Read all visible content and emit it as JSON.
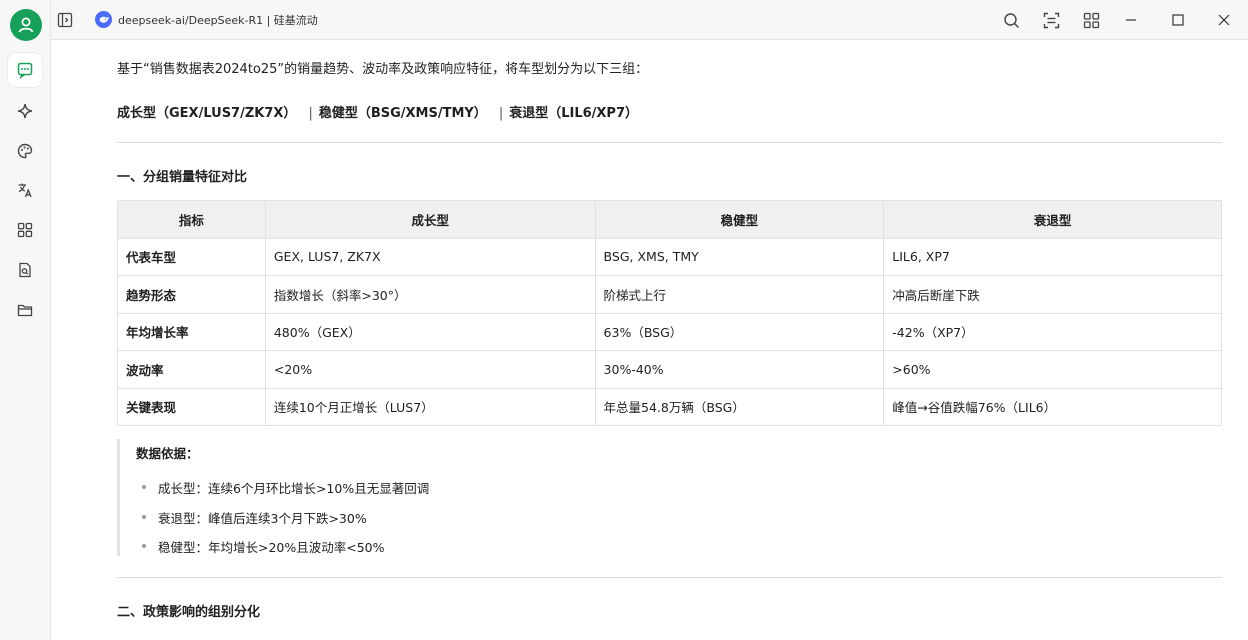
{
  "window": {
    "title": "deepseek-ai/DeepSeek-R1 | 硅基流动"
  },
  "rail": {
    "items": [
      {
        "name": "chat",
        "icon": "chat-icon"
      },
      {
        "name": "sparkle",
        "icon": "sparkle-icon"
      },
      {
        "name": "palette",
        "icon": "palette-icon"
      },
      {
        "name": "translate",
        "icon": "translate-icon"
      },
      {
        "name": "apps",
        "icon": "apps-icon"
      },
      {
        "name": "document",
        "icon": "document-icon"
      },
      {
        "name": "folder",
        "icon": "folder-icon"
      }
    ]
  },
  "content": {
    "intro": "基于“销售数据表2024to25”的销量趋势、波动率及政策响应特征，将车型划分为以下三组：",
    "groups": [
      "成长型（GEX/LUS7/ZK7X）",
      "稳健型（BSG/XMS/TMY）",
      "衰退型（LIL6/XP7）"
    ],
    "group_sep": "|",
    "section1_title": "一、分组销量特征对比",
    "table": {
      "headers": [
        "指标",
        "成长型",
        "稳健型",
        "衰退型"
      ],
      "rows": [
        [
          "代表车型",
          "GEX, LUS7, ZK7X",
          "BSG, XMS, TMY",
          "LIL6, XP7"
        ],
        [
          "趋势形态",
          "指数增长（斜率>30°）",
          "阶梯式上行",
          "冲高后断崖下跌"
        ],
        [
          "年均增长率",
          "480%（GEX）",
          "63%（BSG）",
          "-42%（XP7）"
        ],
        [
          "波动率",
          "<20%",
          "30%-40%",
          ">60%"
        ],
        [
          "关键表现",
          "连续10个月正增长（LUS7）",
          "年总量54.8万辆（BSG）",
          "峰值→谷值跌幅76%（LIL6）"
        ]
      ]
    },
    "basis_title": "数据依据：",
    "basis_items": [
      "成长型：连续6个月环比增长>10%且无显著回调",
      "衰退型：峰值后连续3个月下跌>30%",
      "稳健型：年均增长>20%且波动率<50%"
    ],
    "section2_title": "二、政策影响的组别分化"
  },
  "colors": {
    "accent": "#16a05a",
    "logo": "#4b6bfb",
    "table_header_bg": "#f0f0f0",
    "border": "#e1e1e1"
  }
}
